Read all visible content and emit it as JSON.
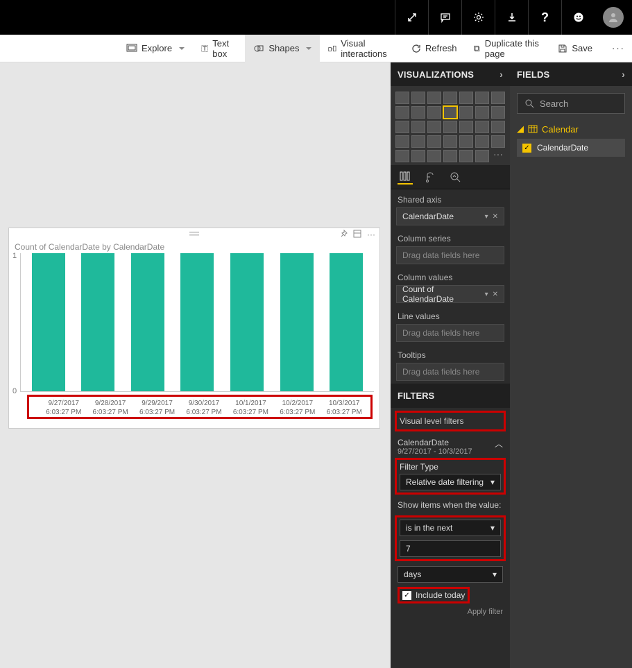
{
  "topbar_icons": [
    "expand",
    "chat",
    "gear",
    "download",
    "help",
    "smiley"
  ],
  "toolbar": {
    "explore": "Explore",
    "textbox": "Text box",
    "shapes": "Shapes",
    "visual_interactions": "Visual interactions",
    "refresh": "Refresh",
    "duplicate": "Duplicate this page",
    "save": "Save"
  },
  "viz_panel": {
    "title": "VISUALIZATIONS",
    "wells": {
      "shared_axis": {
        "label": "Shared axis",
        "value": "CalendarDate"
      },
      "column_series": {
        "label": "Column series",
        "placeholder": "Drag data fields here"
      },
      "column_values": {
        "label": "Column values",
        "value": "Count of CalendarDate"
      },
      "line_values": {
        "label": "Line values",
        "placeholder": "Drag data fields here"
      },
      "tooltips": {
        "label": "Tooltips",
        "placeholder": "Drag data fields here"
      }
    },
    "filters_title": "FILTERS",
    "visual_level_filters": "Visual level filters",
    "filter": {
      "field": "CalendarDate",
      "range": "9/27/2017 - 10/3/2017",
      "type_label": "Filter Type",
      "type_value": "Relative date filtering",
      "show_label": "Show items when the value:",
      "op": "is in the next",
      "num": "7",
      "unit": "days",
      "include_today": "Include today",
      "apply": "Apply filter"
    }
  },
  "fields_panel": {
    "title": "FIELDS",
    "search": "Search",
    "table": "Calendar",
    "field": "CalendarDate"
  },
  "chart_data": {
    "type": "bar",
    "title": "Count of CalendarDate by CalendarDate",
    "categories": [
      {
        "date": "9/27/2017",
        "time": "6:03:27 PM"
      },
      {
        "date": "9/28/2017",
        "time": "6:03:27 PM"
      },
      {
        "date": "9/29/2017",
        "time": "6:03:27 PM"
      },
      {
        "date": "9/30/2017",
        "time": "6:03:27 PM"
      },
      {
        "date": "10/1/2017",
        "time": "6:03:27 PM"
      },
      {
        "date": "10/2/2017",
        "time": "6:03:27 PM"
      },
      {
        "date": "10/3/2017",
        "time": "6:03:27 PM"
      }
    ],
    "values": [
      1,
      1,
      1,
      1,
      1,
      1,
      1
    ],
    "ylabel": "",
    "ylim": [
      0,
      1
    ],
    "yticks": [
      0,
      1
    ]
  }
}
